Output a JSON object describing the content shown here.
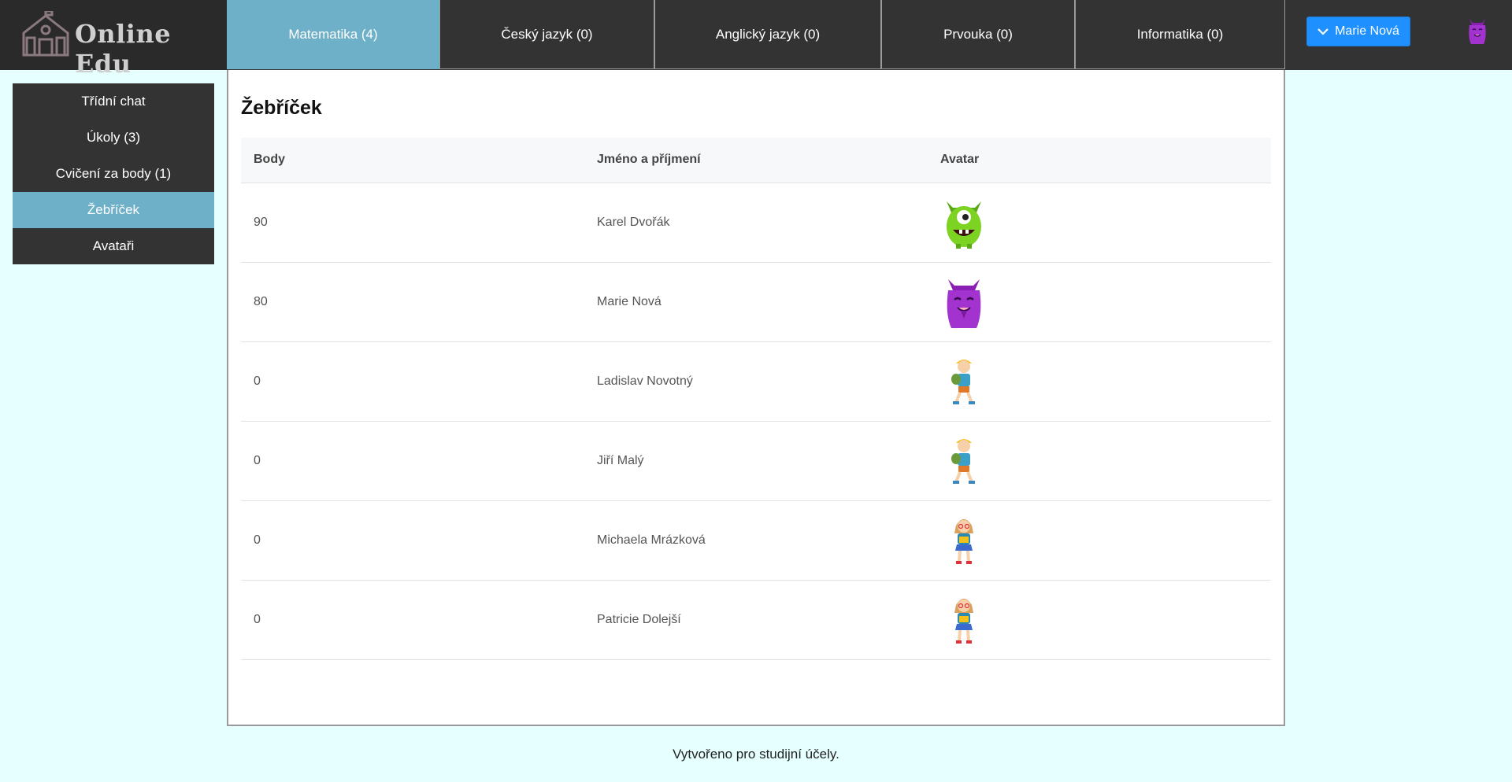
{
  "brand": {
    "name": "Online Edu"
  },
  "tabs": [
    {
      "label": "Matematika (4)",
      "active": true
    },
    {
      "label": "Český jazyk (0)",
      "active": false
    },
    {
      "label": "Anglický jazyk (0)",
      "active": false
    },
    {
      "label": "Prvouka (0)",
      "active": false
    },
    {
      "label": "Informatika (0)",
      "active": false
    }
  ],
  "user": {
    "name": "Marie Nová"
  },
  "sidebar": {
    "items": [
      {
        "label": "Třídní chat"
      },
      {
        "label": "Úkoly (3)"
      },
      {
        "label": "Cvičení za body (1)"
      },
      {
        "label": "Žebříček"
      },
      {
        "label": "Avataři"
      }
    ]
  },
  "main": {
    "title": "Žebříček",
    "table": {
      "headers": [
        "Body",
        "Jméno a příjmení",
        "Avatar"
      ],
      "rows": [
        {
          "points": "90",
          "name": "Karel Dvořák",
          "avatar": "green-monster-icon"
        },
        {
          "points": "80",
          "name": "Marie Nová",
          "avatar": "purple-monster-icon"
        },
        {
          "points": "0",
          "name": "Ladislav Novotný",
          "avatar": "boy-student-icon"
        },
        {
          "points": "0",
          "name": "Jiří Malý",
          "avatar": "boy-student-icon"
        },
        {
          "points": "0",
          "name": "Michaela Mrázková",
          "avatar": "girl-student-icon"
        },
        {
          "points": "0",
          "name": "Patricie Dolejší",
          "avatar": "girl-student-icon"
        }
      ]
    }
  },
  "footer": {
    "text": "Vytvořeno pro studijní účely."
  },
  "colors": {
    "accent": "#6eb0c8",
    "header_bg": "#333333",
    "button_blue": "#1e90ff",
    "page_bg": "#e6ffff"
  }
}
